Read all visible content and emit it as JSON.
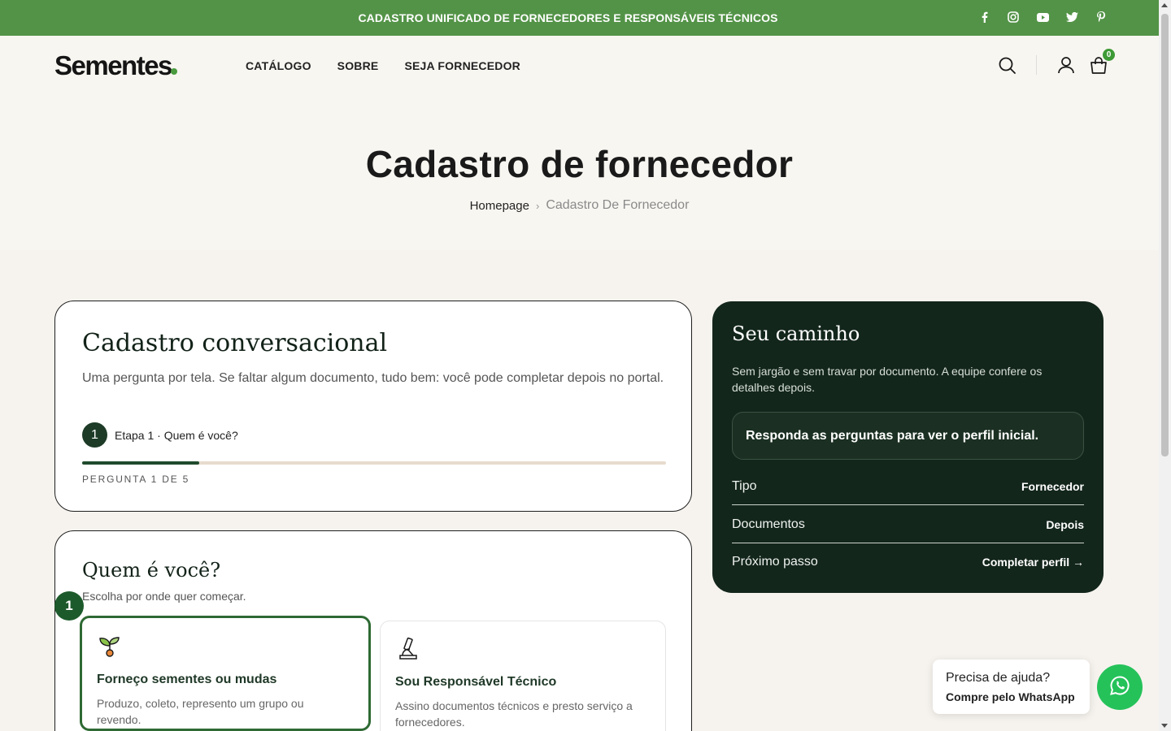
{
  "topbar": {
    "message": "CADASTRO UNIFICADO DE FORNECEDORES E RESPONSÁVEIS TÉCNICOS",
    "social": [
      "facebook-icon",
      "instagram-icon",
      "youtube-icon",
      "twitter-icon",
      "pinterest-icon"
    ],
    "color": "#539347"
  },
  "header": {
    "logo": "Sementes",
    "nav": [
      "CATÁLOGO",
      "SOBRE",
      "SEJA FORNECEDOR"
    ],
    "cart_count": "0"
  },
  "hero": {
    "title": "Cadastro de fornecedor",
    "breadcrumb": {
      "home": "Homepage",
      "current": "Cadastro De Fornecedor"
    }
  },
  "intro_card": {
    "title": "Cadastro conversacional",
    "description": "Uma pergunta por tela. Se faltar algum documento, tudo bem: você pode completar depois no portal.",
    "step_number": "1",
    "step_label": "Etapa 1 · Quem é você?",
    "progress": 0.2,
    "question_count": "PERGUNTA 1 DE 5"
  },
  "question_card": {
    "title": "Quem é você?",
    "subtitle": "Escolha por onde quer começar.",
    "selected_number": "1",
    "options": [
      {
        "icon": "sprout-icon",
        "title": "Forneço sementes ou mudas",
        "description": "Produzo, coleto, represento um grupo ou revendo.",
        "selected": true
      },
      {
        "icon": "microscope-icon",
        "title": "Sou Responsável Técnico",
        "description": "Assino documentos técnicos e presto serviço a fornecedores.",
        "selected": false
      }
    ]
  },
  "sidebar": {
    "title": "Seu caminho",
    "description": "Sem jargão e sem travar por documento. A equipe confere os detalhes depois.",
    "profile_hint": "Responda as perguntas para ver o perfil inicial.",
    "rows": [
      {
        "key": "Tipo",
        "value": "Fornecedor"
      },
      {
        "key": "Documentos",
        "value": "Depois"
      },
      {
        "key": "Próximo passo",
        "value": "Completar perfil →"
      }
    ]
  },
  "help": {
    "title": "Precisa de ajuda?",
    "action": "Compre pelo WhatsApp"
  }
}
